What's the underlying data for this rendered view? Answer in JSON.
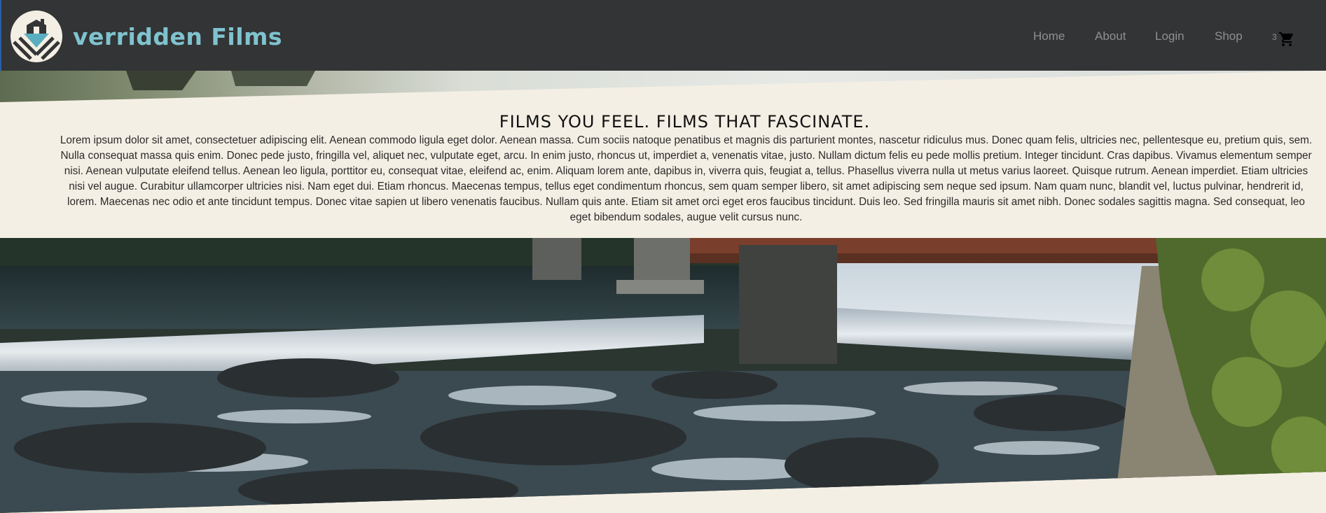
{
  "header": {
    "brand": "verridden Films",
    "nav": [
      {
        "label": "Home"
      },
      {
        "label": "About"
      },
      {
        "label": "Login"
      },
      {
        "label": "Shop"
      }
    ],
    "cart_count": "3"
  },
  "intro": {
    "headline": "FILMS YOU FEEL. FILMS THAT FASCINATE.",
    "body": "Lorem ipsum dolor sit amet, consectetuer adipiscing elit. Aenean commodo ligula eget dolor. Aenean massa. Cum sociis natoque penatibus et magnis dis parturient montes, nascetur ridiculus mus. Donec quam felis, ultricies nec, pellentesque eu, pretium quis, sem. Nulla consequat massa quis enim. Donec pede justo, fringilla vel, aliquet nec, vulputate eget, arcu. In enim justo, rhoncus ut, imperdiet a, venenatis vitae, justo. Nullam dictum felis eu pede mollis pretium. Integer tincidunt. Cras dapibus. Vivamus elementum semper nisi. Aenean vulputate eleifend tellus. Aenean leo ligula, porttitor eu, consequat vitae, eleifend ac, enim. Aliquam lorem ante, dapibus in, viverra quis, feugiat a, tellus. Phasellus viverra nulla ut metus varius laoreet. Quisque rutrum. Aenean imperdiet. Etiam ultricies nisi vel augue. Curabitur ullamcorper ultricies nisi. Nam eget dui. Etiam rhoncus. Maecenas tempus, tellus eget condimentum rhoncus, sem quam semper libero, sit amet adipiscing sem neque sed ipsum. Nam quam nunc, blandit vel, luctus pulvinar, hendrerit id, lorem. Maecenas nec odio et ante tincidunt tempus. Donec vitae sapien ut libero venenatis faucibus. Nullam quis ante. Etiam sit amet orci eget eros faucibus tincidunt. Duis leo. Sed fringilla mauris sit amet nibh. Donec sodales sagittis magna. Sed consequat, leo eget bibendum sodales, augue velit cursus nunc."
  },
  "icons": {
    "logo": "house-heart-emblem-icon",
    "cart": "shopping-cart-icon"
  },
  "colors": {
    "header_bg": "#333435",
    "brand": "#7fc3cf",
    "nav_text": "#8d8f92",
    "page_bg": "#f4efe4"
  }
}
